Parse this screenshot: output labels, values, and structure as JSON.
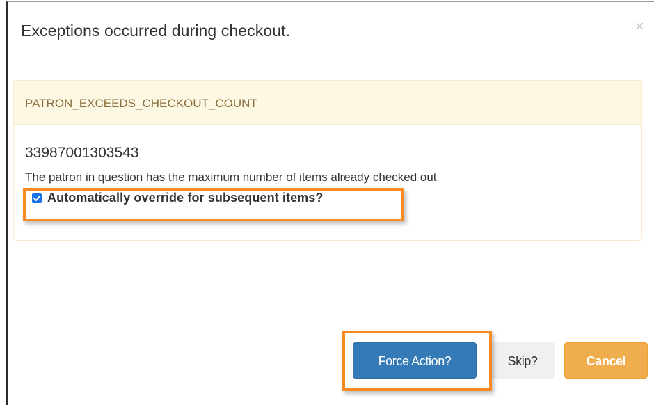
{
  "modal": {
    "title": "Exceptions occurred during checkout.",
    "close_icon": "×"
  },
  "exception": {
    "code": "PATRON_EXCEEDS_CHECKOUT_COUNT",
    "barcode": "33987001303543",
    "message": "The patron in question has the maximum number of items already checked out",
    "override_label": "Automatically override for subsequent items?",
    "override_checked": true
  },
  "buttons": {
    "force_label": "Force Action?",
    "skip_label": "Skip?",
    "cancel_label": "Cancel"
  },
  "colors": {
    "highlight": "#f68b1f",
    "primary": "#337ab7",
    "warning": "#f0ad4e",
    "panel_heading_bg": "#fcf8e3",
    "panel_heading_text": "#8a6d3b"
  },
  "icons": {
    "close": "close-icon",
    "checkbox": "checkbox-checked-icon"
  }
}
